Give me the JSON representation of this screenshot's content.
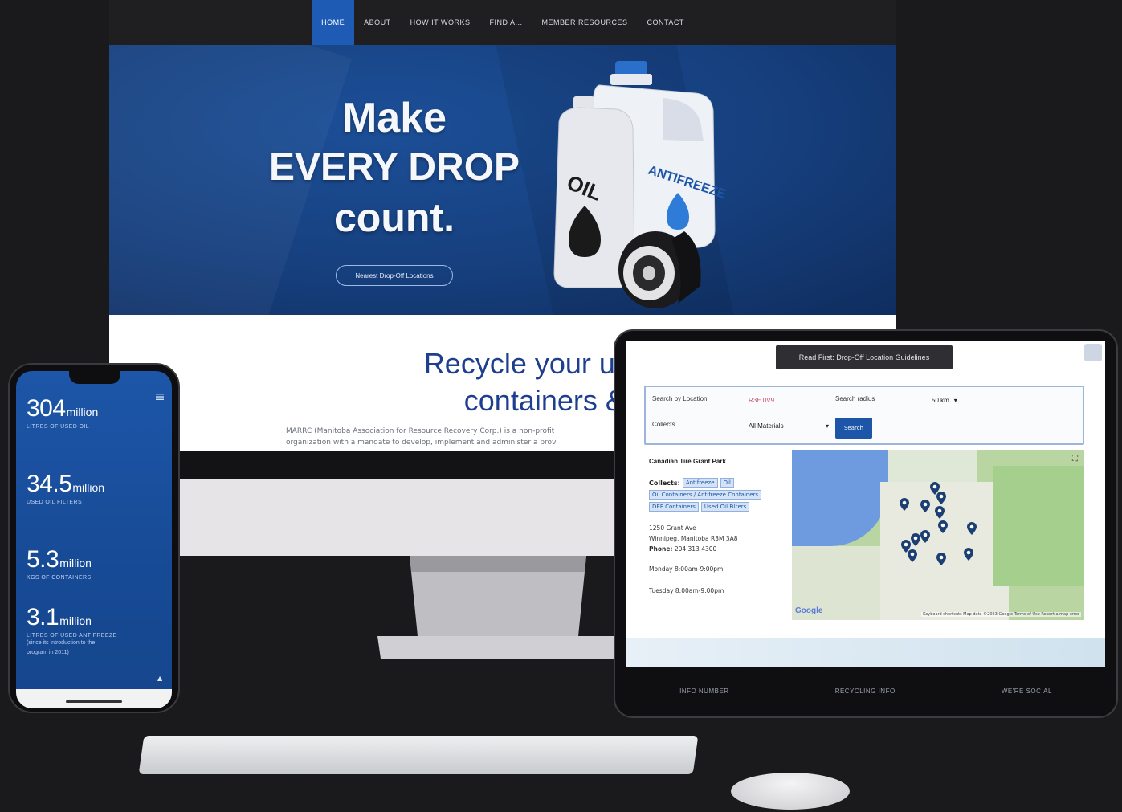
{
  "desktop": {
    "nav": [
      {
        "label": "HOME",
        "active": true
      },
      {
        "label": "ABOUT",
        "active": false
      },
      {
        "label": "HOW IT WORKS",
        "active": false
      },
      {
        "label": "FIND A...",
        "active": false
      },
      {
        "label": "MEMBER RESOURCES",
        "active": false
      },
      {
        "label": "CONTACT",
        "active": false
      }
    ],
    "hero": {
      "line1": "Make",
      "line2": "EVERY DROP",
      "line3": "count.",
      "cta": "Nearest Drop-Off Locations",
      "product_labels": {
        "oil": "OIL",
        "antifreeze": "ANTIFREEZE"
      }
    },
    "intro": {
      "heading_line1": "Recycle your used oil, filte",
      "heading_line2": "containers & antifreeze",
      "text_line1": "MARRC (Manitoba Association for Resource Recovery Corp.) is a non-profit",
      "text_line2": "organization with a mandate to develop, implement and administer a prov"
    },
    "colors": {
      "brand_blue": "#1d56a8",
      "hero_blue": "#163f7d",
      "heading_blue": "#1e3f8f"
    }
  },
  "phone": {
    "stats": [
      {
        "number": "304",
        "unit": "million",
        "label": "LITRES OF USED OIL"
      },
      {
        "number": "34.5",
        "unit": "million",
        "label": "USED OIL FILTERS"
      },
      {
        "number": "5.3",
        "unit": "million",
        "label": "KGS OF CONTAINERS"
      },
      {
        "number": "3.1",
        "unit": "million",
        "label": "LITRES OF USED ANTIFREEZE",
        "note_line1": "(since its introduction to the",
        "note_line2": "program in 2011)"
      }
    ],
    "menu_icon": "hamburger-icon",
    "scroll_icon": "arrow-up-icon"
  },
  "tablet": {
    "guidelines_button": "Read First: Drop-Off Location Guidelines",
    "search": {
      "location_label": "Search by Location",
      "location_value": "R3E 0V9",
      "radius_label": "Search radius",
      "radius_value": "50 km",
      "collects_label": "Collects",
      "collects_value": "All Materials",
      "button": "Search"
    },
    "location": {
      "name": "Canadian Tire Grant Park",
      "collects_label": "Collects:",
      "tags": [
        "Antifreeze",
        "Oil",
        "Oil Containers / Antifreeze Containers",
        "DEF Containers",
        "Used Oil Filters"
      ],
      "address_line1": "1250 Grant Ave",
      "address_line2": "Winnipeg, Manitoba R3M 3A8",
      "phone_label": "Phone:",
      "phone_value": "204 313 4300",
      "hours1": "Monday 8:00am-9:00pm",
      "hours2": "Tuesday 8:00am-9:00pm"
    },
    "map": {
      "brand": "Google",
      "attribution": "Keyboard shortcuts  Map data ©2023 Google  Terms of Use  Report a map error",
      "fullscreen_icon": "fullscreen-icon"
    },
    "footer": [
      "INFO NUMBER",
      "RECYCLING INFO",
      "WE'RE SOCIAL"
    ]
  }
}
